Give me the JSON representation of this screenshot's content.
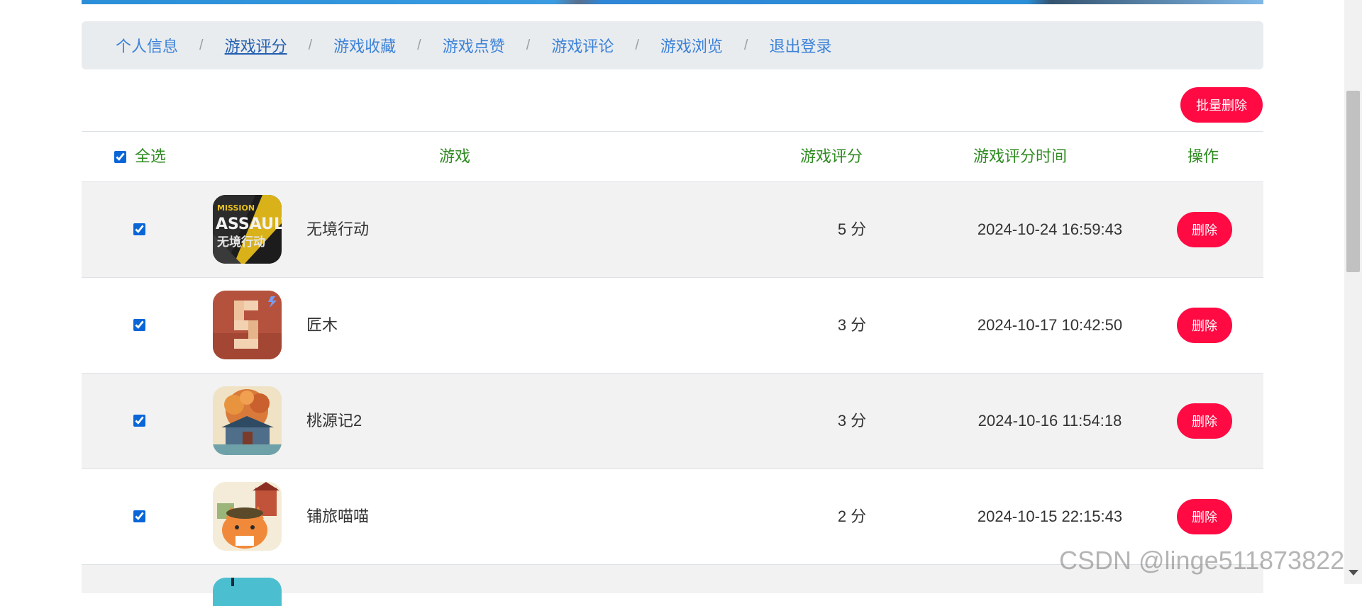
{
  "nav": {
    "items": [
      {
        "label": "个人信息"
      },
      {
        "label": "游戏评分"
      },
      {
        "label": "游戏收藏"
      },
      {
        "label": "游戏点赞"
      },
      {
        "label": "游戏评论"
      },
      {
        "label": "游戏浏览"
      },
      {
        "label": "退出登录"
      }
    ],
    "separator": "/",
    "active": "游戏评分"
  },
  "toolbar": {
    "batch_delete_label": "批量删除"
  },
  "table": {
    "headers": {
      "select_all": "全选",
      "game": "游戏",
      "score": "游戏评分",
      "time": "游戏评分时间",
      "operation": "操作"
    },
    "select_all_checked": true,
    "rows": [
      {
        "name": "无境行动",
        "score": "5 分",
        "time": "2024-10-24 16:59:43",
        "delete_label": "删除",
        "checked": true,
        "thumb_icon": "mission-assault-game-icon",
        "thumb_text_1": "MISSION",
        "thumb_text_2": "ASSAULT",
        "thumb_text_3": "无境行动"
      },
      {
        "name": "匠木",
        "score": "3 分",
        "time": "2024-10-17 10:42:50",
        "delete_label": "删除",
        "checked": true,
        "thumb_icon": "wood-puzzle-game-icon"
      },
      {
        "name": "桃源记2",
        "score": "3 分",
        "time": "2024-10-16 11:54:18",
        "delete_label": "删除",
        "checked": true,
        "thumb_icon": "peach-garden-game-icon"
      },
      {
        "name": "铺旅喵喵",
        "score": "2 分",
        "time": "2024-10-15 22:15:43",
        "delete_label": "删除",
        "checked": true,
        "thumb_icon": "cat-shop-game-icon"
      }
    ]
  },
  "watermark": "CSDN @linge511873822",
  "colors": {
    "accent_red": "#ff0a43",
    "header_green": "#2e8b20",
    "link_blue": "#3b82d8",
    "stripe_gray": "#f2f2f2"
  }
}
